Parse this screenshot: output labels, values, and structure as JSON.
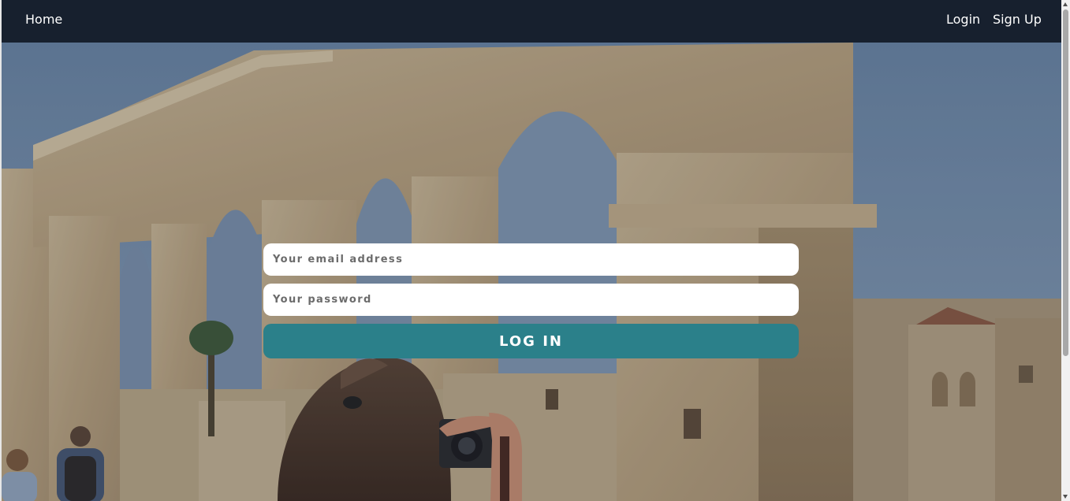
{
  "nav": {
    "home_label": "Home",
    "login_label": "Login",
    "signup_label": "Sign Up"
  },
  "login_form": {
    "email_placeholder": "Your email address",
    "password_placeholder": "Your password",
    "submit_label": "LOG IN"
  },
  "colors": {
    "navbar_bg": "#17202e",
    "button_bg": "#2b808a",
    "input_bg": "#ffffff"
  }
}
